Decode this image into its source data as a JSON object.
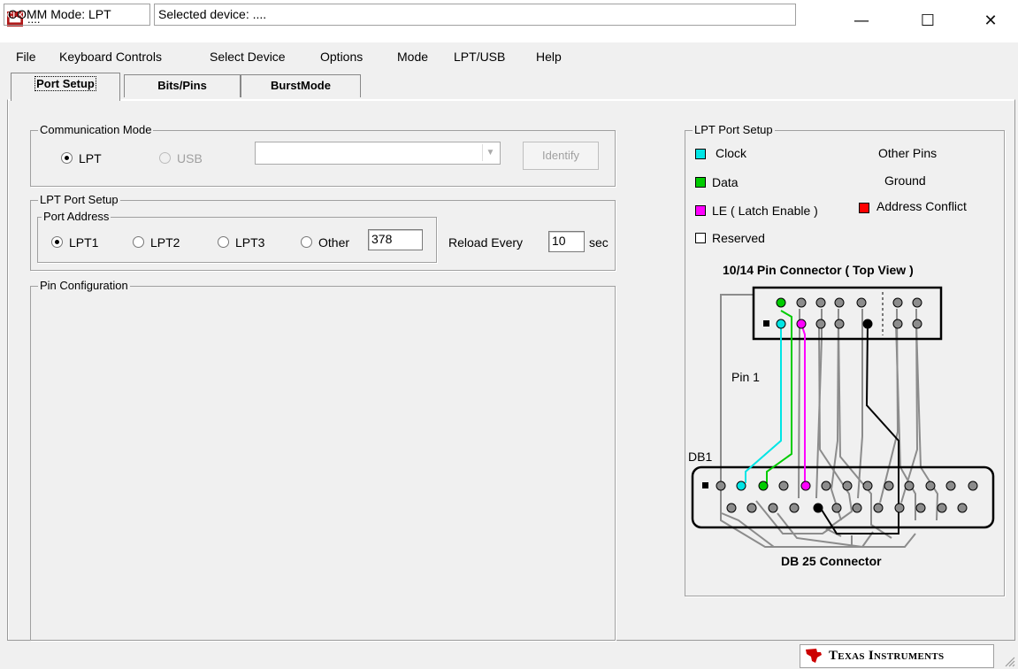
{
  "window": {
    "title": "....",
    "app_icon_text": "CLK\nTOOL",
    "controls": {
      "minimize": "—",
      "maximize": "☐",
      "close": "✕"
    }
  },
  "menu": [
    "File",
    "Keyboard Controls",
    "Select Device",
    "Options",
    "Mode",
    "LPT/USB",
    "Help"
  ],
  "tabs": [
    {
      "label": "Port Setup",
      "active": true
    },
    {
      "label": "Bits/Pins",
      "active": false
    },
    {
      "label": "BurstMode",
      "active": false
    }
  ],
  "comm_mode": {
    "legend": "Communication Mode",
    "lpt_label": "LPT",
    "usb_label": "USB",
    "selected": "LPT",
    "device_combo_value": "",
    "identify_label": "Identify"
  },
  "lpt_setup": {
    "legend": "LPT Port Setup",
    "port_address_legend": "Port Address",
    "options": [
      "LPT1",
      "LPT2",
      "LPT3",
      "Other"
    ],
    "selected": "LPT1",
    "other_value": "378",
    "reload_label": "Reload Every",
    "reload_value": "10",
    "reload_unit": "sec"
  },
  "pin_config": {
    "legend": "Pin Configuration"
  },
  "right_panel": {
    "legend": "LPT Port Setup",
    "legend_items": [
      {
        "label": "Clock",
        "color": "#00e5e5"
      },
      {
        "label": "Data",
        "color": "#00cc00"
      },
      {
        "label": "LE ( Latch Enable )",
        "color": "#ff00ff"
      },
      {
        "label": "Reserved",
        "color": "#ffffff"
      },
      {
        "label": "Address Conflict",
        "color": "#ff0000"
      }
    ],
    "other_pins_label": "Other Pins",
    "ground_label": "Ground",
    "connector_title": "10/14 Pin Connector ( Top View )",
    "pin1_label": "Pin 1",
    "db1_label": "DB1",
    "db25_label": "DB 25 Connector"
  },
  "status": {
    "comm_mode": "COMM Mode: LPT",
    "selected_device": "Selected device: ....",
    "vendor": "Texas Instruments"
  },
  "colors": {
    "pin_gray": "#8c8c8c",
    "wire_gray": "#8c8c8c",
    "clock": "#00e5e5",
    "data": "#00cc00",
    "le": "#ff00ff",
    "ground": "#000000",
    "ti_red": "#cc0000"
  }
}
